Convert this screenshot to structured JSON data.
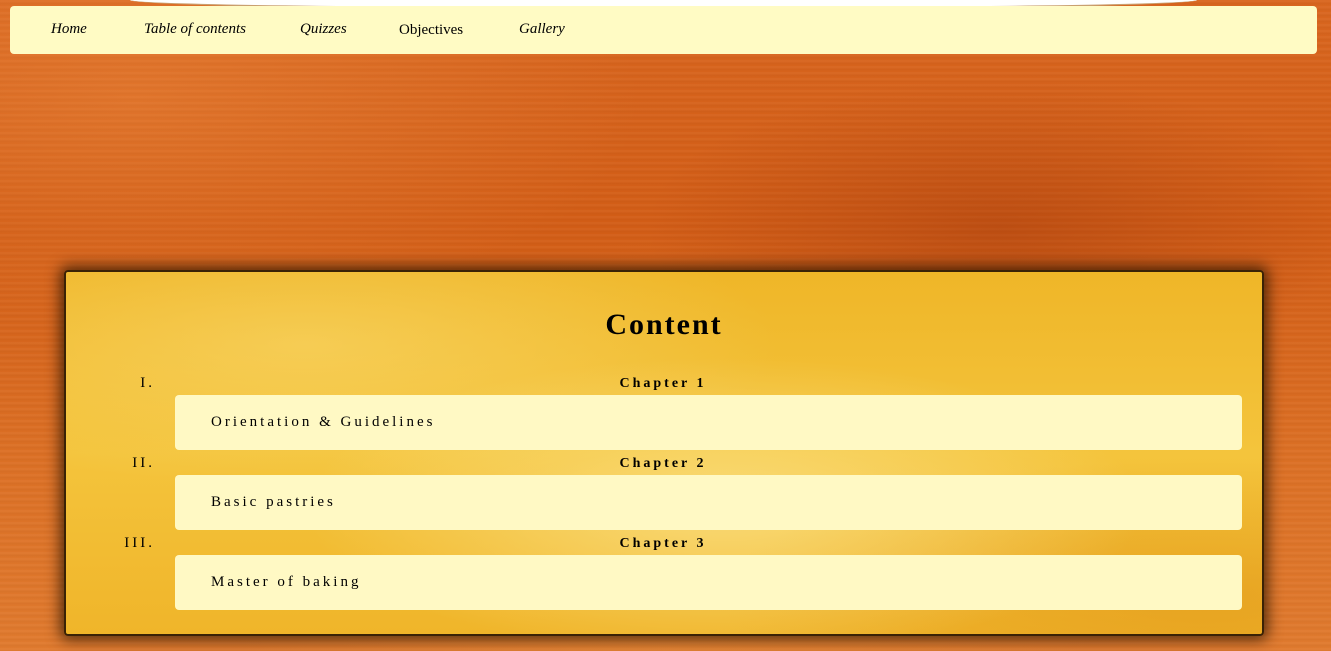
{
  "nav": {
    "items": [
      {
        "label": "Home"
      },
      {
        "label": "Table of contents"
      },
      {
        "label": "Quizzes"
      },
      {
        "label": "Objectives"
      },
      {
        "label": "Gallery"
      }
    ]
  },
  "content": {
    "title": "Content",
    "chapters": [
      {
        "numeral": "I.",
        "heading": "Chapter 1",
        "title": "Orientation & Guidelines"
      },
      {
        "numeral": "II.",
        "heading": "Chapter 2",
        "title": "Basic pastries"
      },
      {
        "numeral": "III.",
        "heading": "Chapter 3",
        "title": "Master of baking"
      }
    ]
  },
  "colors": {
    "background": "#d35d16",
    "navbar": "#fffbc4",
    "panel": "#f4c43c",
    "chapter_box": "#fff9c4",
    "text": "#000000"
  }
}
